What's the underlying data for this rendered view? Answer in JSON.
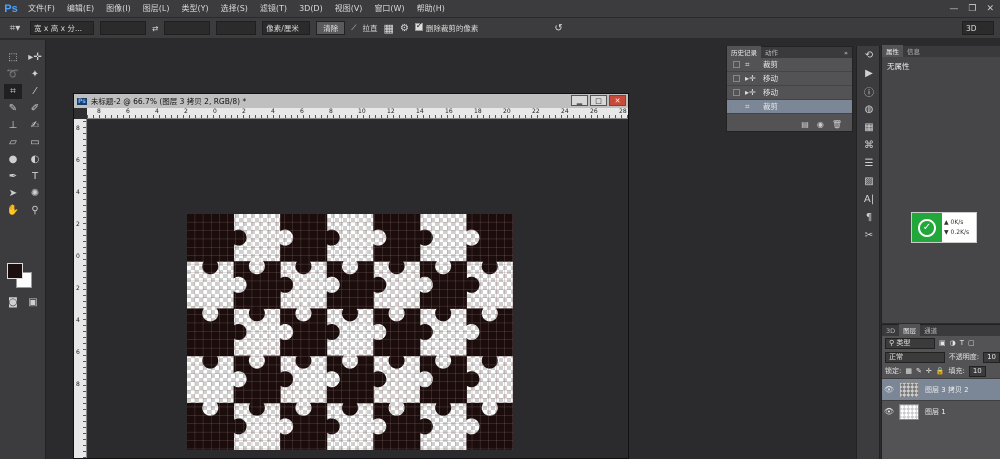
{
  "app": {
    "logo": "Ps"
  },
  "menu": [
    "文件(F)",
    "编辑(E)",
    "图像(I)",
    "图层(L)",
    "类型(Y)",
    "选择(S)",
    "滤镜(T)",
    "3D(D)",
    "视图(V)",
    "窗口(W)",
    "帮助(H)"
  ],
  "options": {
    "preset": "宽 x 高 x 分...",
    "unit": "像素/厘米",
    "clear_label": "清除",
    "straighten_label": "拉直",
    "delete_cropped_label": "删除裁剪的像素",
    "workspace": "3D"
  },
  "document": {
    "title": "未标题-2 @ 66.7% (图层 3 拷贝 2, RGB/8) *",
    "ruler_h": [
      "8",
      "6",
      "4",
      "2",
      "0",
      "2",
      "4",
      "6",
      "8",
      "10",
      "12",
      "14",
      "16",
      "18",
      "20",
      "22",
      "24",
      "26",
      "28"
    ],
    "ruler_v": [
      "8",
      "6",
      "4",
      "2",
      "0",
      "2",
      "4",
      "6",
      "8"
    ]
  },
  "history": {
    "tabs": [
      "历史记录",
      "动作"
    ],
    "rows": [
      {
        "label": "裁剪",
        "icon": "crop-icon"
      },
      {
        "label": "移动",
        "icon": "move-icon"
      },
      {
        "label": "移动",
        "icon": "move-icon"
      },
      {
        "label": "裁剪",
        "icon": "crop-icon"
      }
    ]
  },
  "properties": {
    "tabs": [
      "属性",
      "信息"
    ],
    "no_properties": "无属性"
  },
  "speed": {
    "up": "0K/s",
    "down": "0.2K/s"
  },
  "layers": {
    "tabs": [
      "3D",
      "图层",
      "通道"
    ],
    "filter_kind": "类型",
    "blend_mode": "正常",
    "opacity_label": "不透明度:",
    "opacity_value": "10",
    "lock_label": "锁定:",
    "fill_label": "填充:",
    "fill_value": "10",
    "items": [
      {
        "name": "图层 3 拷贝 2"
      },
      {
        "name": "图层 1"
      }
    ]
  },
  "colors": {
    "foreground": "#1b0f0f",
    "background": "#ffffff",
    "accent": "#7b8797"
  }
}
